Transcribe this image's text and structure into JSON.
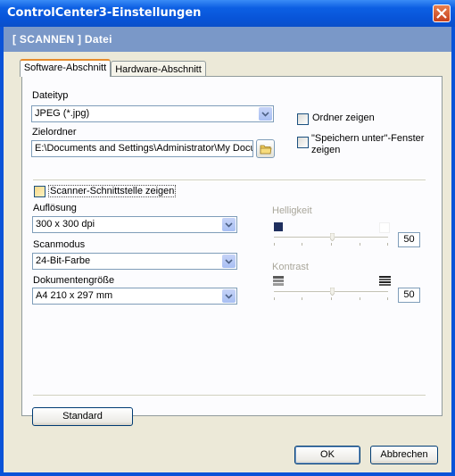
{
  "window": {
    "title": "ControlCenter3-Einstellungen"
  },
  "header": {
    "text": "[ SCANNEN ]   Datei"
  },
  "tabs": [
    {
      "label": "Software-Abschnitt"
    },
    {
      "label": "Hardware-Abschnitt"
    }
  ],
  "file_type": {
    "label": "Dateityp",
    "value": "JPEG (*.jpg)"
  },
  "target_folder": {
    "label": "Zielordner",
    "value": "E:\\Documents and Settings\\Administrator\\My Docume"
  },
  "show_folder": {
    "label": "Ordner zeigen",
    "checked": false
  },
  "save_as": {
    "label_line1": "\"Speichern unter\"-Fenster",
    "label_line2": "zeigen",
    "checked": false
  },
  "show_scanner_ui": {
    "label": "Scanner-Schnittstelle zeigen",
    "checked": false
  },
  "resolution": {
    "label": "Auflösung",
    "value": "300 x 300 dpi"
  },
  "scan_mode": {
    "label": "Scanmodus",
    "value": "24-Bit-Farbe"
  },
  "doc_size": {
    "label": "Dokumentengröße",
    "value": "A4 210 x 297 mm"
  },
  "brightness": {
    "label": "Helligkeit",
    "value": "50"
  },
  "contrast": {
    "label": "Kontrast",
    "value": "50"
  },
  "buttons": {
    "standard": "Standard",
    "ok": "OK",
    "cancel": "Abbrechen"
  },
  "colors": {
    "titlebar": "#0a53d8",
    "header": "#7a98c8",
    "dialog": "#ece9d8",
    "tab_accent": "#e68b2c"
  }
}
